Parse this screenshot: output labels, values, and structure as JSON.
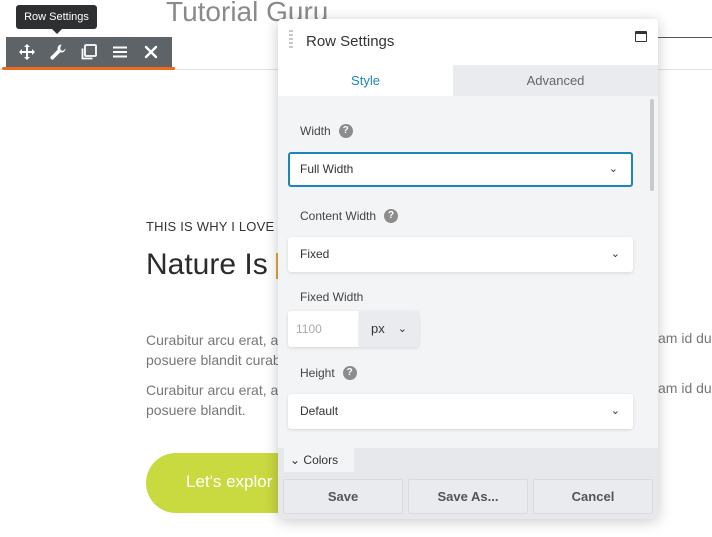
{
  "site": {
    "title": "Tutorial Guru",
    "eyebrow": "THIS IS WHY I LOVE",
    "headline": "Nature Is",
    "para1_line1": "Curabitur arcu erat, a",
    "para1_line1_right": "am id dui",
    "para1_line2": "posuere blandit curab",
    "para2_line1": "Curabitur arcu erat, a",
    "para2_line1_right": "am id dui",
    "para2_line2": "posuere blandit.",
    "cta": "Let's explor"
  },
  "toolbar": {
    "tooltip": "Row Settings",
    "buttons": [
      "move-icon",
      "wrench-icon",
      "duplicate-icon",
      "menu-icon",
      "close-icon"
    ],
    "accent_color": "#ee6a1f"
  },
  "modal": {
    "title": "Row Settings",
    "tabs": [
      {
        "label": "Style",
        "active": true
      },
      {
        "label": "Advanced",
        "active": false
      }
    ],
    "fields": {
      "width_label": "Width",
      "width_value": "Full Width",
      "content_width_label": "Content Width",
      "content_width_value": "Fixed",
      "fixed_width_label": "Fixed Width",
      "fixed_width_placeholder": "1100",
      "fixed_width_unit": "px",
      "height_label": "Height",
      "height_value": "Default"
    },
    "section_colors": "Colors",
    "buttons": {
      "save": "Save",
      "save_as": "Save As...",
      "cancel": "Cancel"
    },
    "accent_color": "#1b86b7"
  },
  "icons": {
    "help": "?",
    "chevron": "⌄"
  }
}
